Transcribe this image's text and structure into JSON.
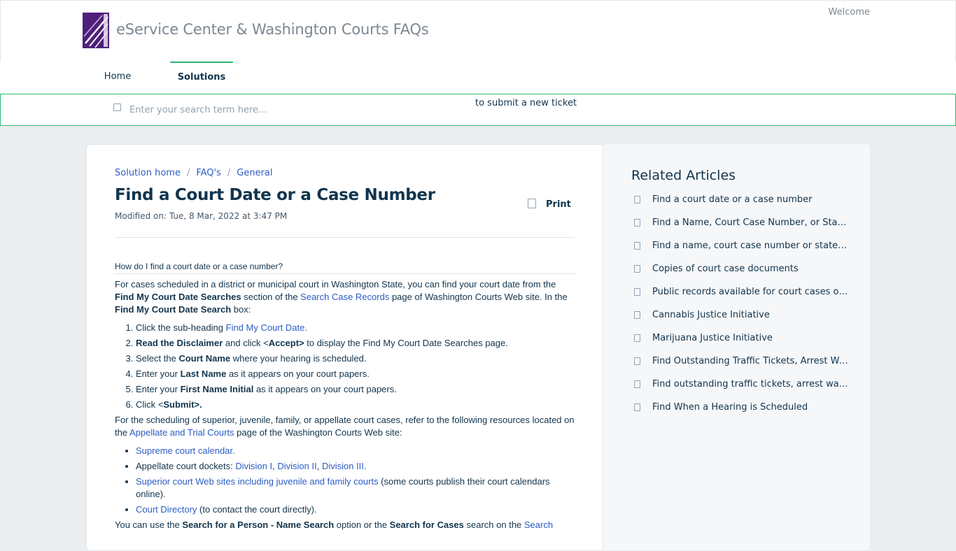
{
  "header": {
    "brand": "eService Center & Washington Courts FAQs",
    "welcome": "Welcome"
  },
  "nav": {
    "home": "Home",
    "solutions": "Solutions"
  },
  "search": {
    "placeholder": "Enter your search term here...",
    "submit_text": "to submit a new ticket"
  },
  "breadcrumb": {
    "items": [
      "Solution home",
      "FAQ's",
      "General"
    ],
    "separator": "/"
  },
  "article": {
    "title": "Find a Court Date or a Case Number",
    "modified": "Modified on: Tue, 8 Mar, 2022 at 3:47 PM",
    "print_label": "Print",
    "question": "How do I find a court date or a case number?",
    "intro": {
      "p1": "For cases scheduled in a district or municipal court in Washington State, you can find your court date from the ",
      "b1": "Find My Court Date Searches",
      "p2": " section of the ",
      "link1": "Search Case Records",
      "p3": " page of Washington Courts Web site.  In the ",
      "b2": "Find My Court Date Search",
      "p4": " box:"
    },
    "steps": [
      {
        "a": "Click the sub-heading ",
        "link": "Find My Court Date."
      },
      {
        "b": "Read the Disclaimer",
        "a": " and click <",
        "b2": "Accept>",
        "c": " to display the Find My Court Date Searches page."
      },
      {
        "a": "Select the ",
        "b": "Court Name",
        "c": " where your hearing is scheduled."
      },
      {
        "a": "Enter your ",
        "b": "Last Name",
        "c": " as it appears on your court papers."
      },
      {
        "a": "Enter your ",
        "b": "First Name Initial",
        "c": " as it appears on your court papers."
      },
      {
        "a": "Click <",
        "b": "Submit>."
      }
    ],
    "para2": {
      "a": "For the scheduling of superior, juvenile, family, or appellate court cases, refer to the following resources located on the ",
      "link": "Appellate and Trial Courts",
      "b": " page of the Washington Courts Web site:"
    },
    "resources": {
      "supreme": "Supreme court calendar.",
      "appellate_label": "Appellate court dockets:  ",
      "div1": "Division I",
      "div2": "Division II",
      "div3": "Division III",
      "comma": ", ",
      "period": ".",
      "superior_link": "Superior court Web sites including juvenile and family courts",
      "superior_rest": " (some courts publish their court calendars online).",
      "directory_link": "Court Directory",
      "directory_rest": " (to contact the court directly)."
    },
    "para3": {
      "a": "You can use the ",
      "b1": "Search for a Person - Name Search",
      "c": " option or the ",
      "b2": "Search for Cases",
      "d": " search on the ",
      "link": "Search"
    }
  },
  "related": {
    "title": "Related Articles",
    "items": [
      "Find a court date or a case number",
      "Find a Name, Court Case Number, or State L...",
      "Find a name, court case number or state law",
      "Copies of court case documents",
      "Public records available for court cases on t...",
      "Cannabis Justice Initiative",
      "Marijuana Justice Initiative",
      "Find Outstanding Traffic Tickets, Arrest Warr...",
      "Find outstanding traffic tickets, arrest warra...",
      "Find When a Hearing is Scheduled"
    ]
  }
}
